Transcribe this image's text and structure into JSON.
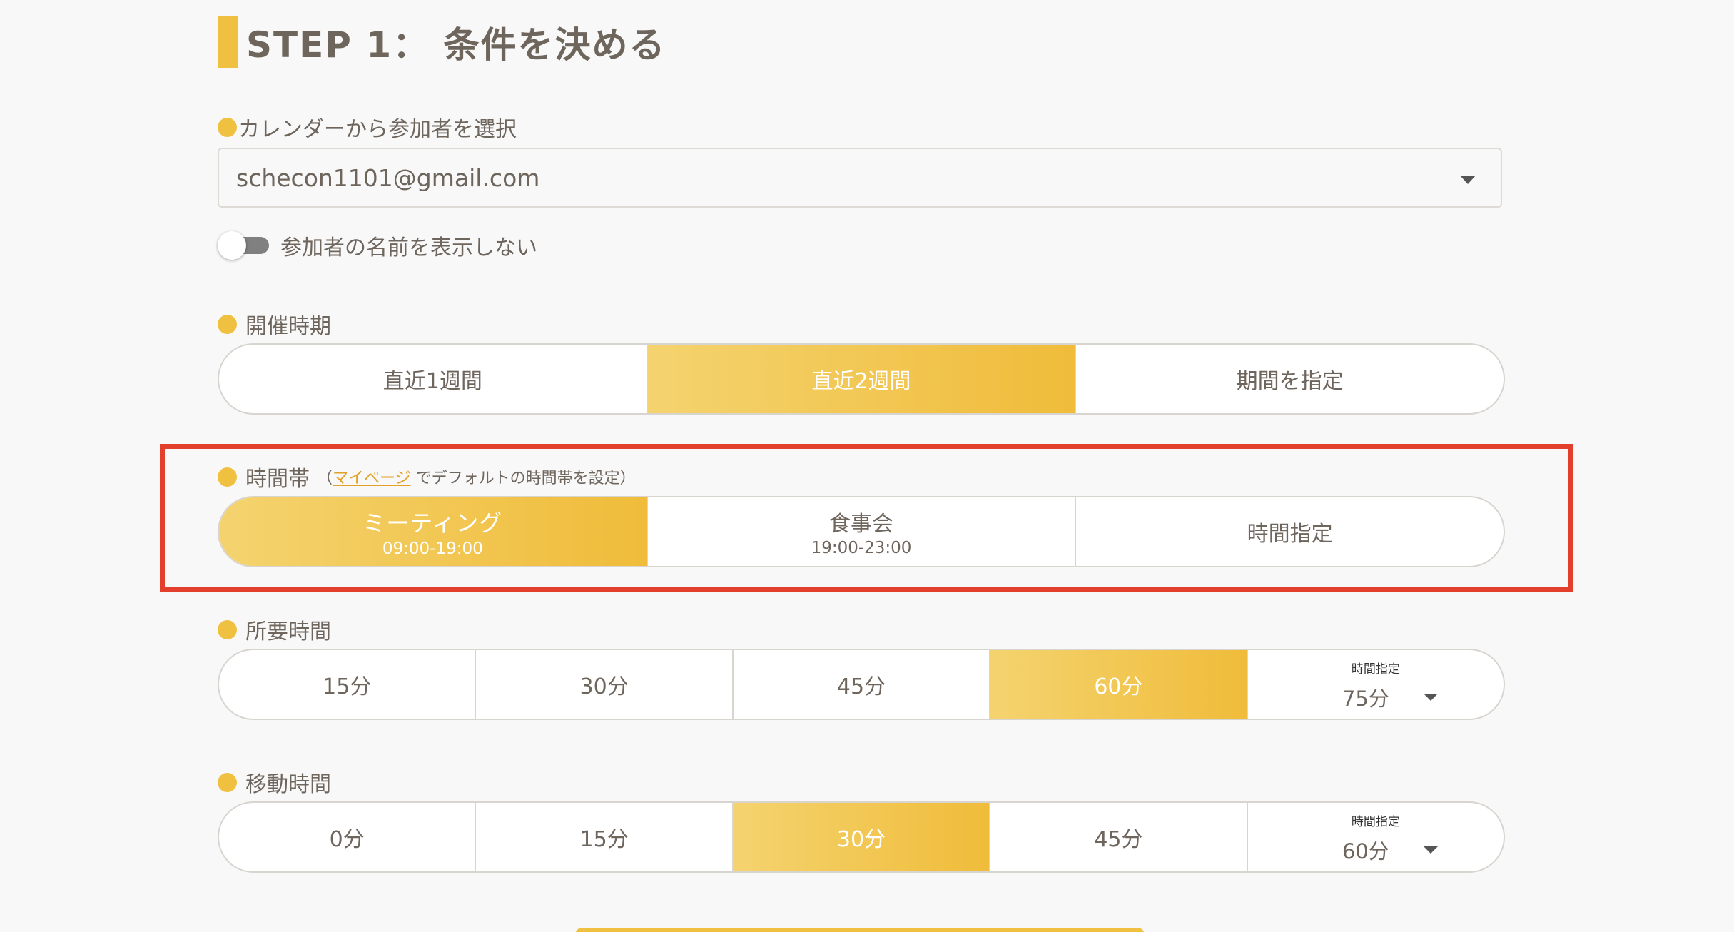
{
  "step": {
    "title": "STEP 1： 条件を決める"
  },
  "calendar": {
    "label": "カレンダーから参加者を選択",
    "selected": "schecon1101@gmail.com"
  },
  "hide_names": {
    "label": "参加者の名前を表示しない",
    "checked": false
  },
  "period": {
    "label": "開催時期",
    "options": [
      "直近1週間",
      "直近2週間",
      "期間を指定"
    ],
    "selected": "直近2週間"
  },
  "timeslot": {
    "label": "時間帯",
    "hint_prefix": "（",
    "hint_link": "マイページ",
    "hint_suffix": " でデフォルトの時間帯を設定）",
    "options": [
      {
        "label": "ミーティング",
        "range": "09:00-19:00"
      },
      {
        "label": "食事会",
        "range": "19:00-23:00"
      },
      {
        "label": "時間指定"
      }
    ],
    "selected": "ミーティング"
  },
  "duration": {
    "label": "所要時間",
    "options": [
      "15分",
      "30分",
      "45分",
      "60分"
    ],
    "selected": "60分",
    "custom_label": "時間指定",
    "custom_value": "75分"
  },
  "travel": {
    "label": "移動時間",
    "options": [
      "0分",
      "15分",
      "30分",
      "45分"
    ],
    "selected": "30分",
    "custom_label": "時間指定",
    "custom_value": "60分"
  },
  "colors": {
    "accent": "#f0c040",
    "highlight_box": "#e2402c",
    "link": "#e3a128"
  }
}
